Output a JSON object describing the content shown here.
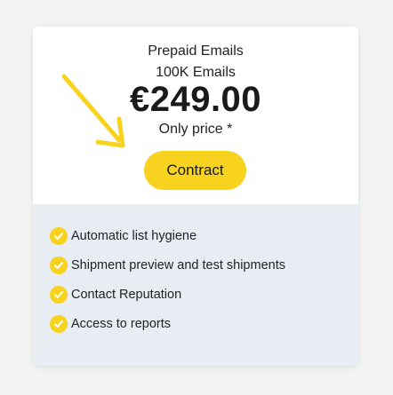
{
  "plan": {
    "name": "Prepaid Emails",
    "quantity": "100K Emails",
    "price": "€249.00",
    "price_note": "Only price *",
    "cta_label": "Contract"
  },
  "features": [
    {
      "label": "Automatic list hygiene",
      "icon": "check-circle-icon"
    },
    {
      "label": "Shipment preview and test shipments",
      "icon": "check-circle-icon"
    },
    {
      "label": "Contact Reputation",
      "icon": "check-circle-icon"
    },
    {
      "label": "Access to reports",
      "icon": "check-circle-icon"
    }
  ],
  "colors": {
    "accent": "#f7d21f",
    "features_background": "#e8edf4",
    "page_background": "#f3f3f3"
  }
}
